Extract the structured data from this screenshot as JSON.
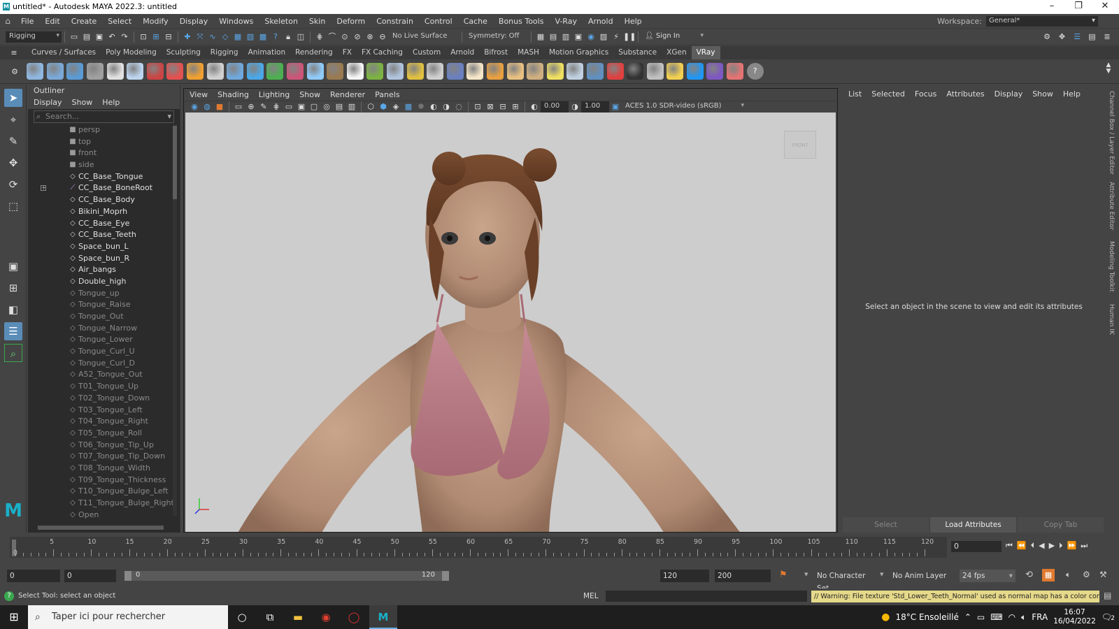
{
  "window": {
    "title": "untitled* - Autodesk MAYA 2022.3: untitled",
    "logo_letter": "M"
  },
  "menu": [
    "File",
    "Edit",
    "Create",
    "Select",
    "Modify",
    "Display",
    "Windows",
    "Skeleton",
    "Skin",
    "Deform",
    "Constrain",
    "Control",
    "Cache",
    "Bonus Tools",
    "V-Ray",
    "Arnold",
    "Help"
  ],
  "workspace": {
    "label": "Workspace:",
    "value": "General*"
  },
  "status": {
    "mode": "Rigging",
    "live_surface": "No Live Surface",
    "symmetry": "Symmetry: Off",
    "sign_in": "Sign In"
  },
  "shelf_tabs": [
    "Curves / Surfaces",
    "Poly Modeling",
    "Sculpting",
    "Rigging",
    "Animation",
    "Rendering",
    "FX",
    "FX Caching",
    "Custom",
    "Arnold",
    "Bifrost",
    "MASH",
    "Motion Graphics",
    "Substance",
    "XGen",
    "VRay"
  ],
  "shelf_active": "VRay",
  "shelf_icon_colors": [
    "#8fb7e0",
    "#7aa9d8",
    "#5b9bd5",
    "#a0a0a0",
    "#e0e0e0",
    "#bcd4ee",
    "#c44",
    "#e35050",
    "#f0a030",
    "#d0d0d0",
    "#6fa8dc",
    "#4aa8e8",
    "#4caf50",
    "#cc5577",
    "#90caf9",
    "#9a7a50",
    "#f5f5f5",
    "#7cb342",
    "#b0c4de",
    "#e0c040",
    "#cfcfcf",
    "#6a80c0",
    "#f5e6c8",
    "#e8a040",
    "#e8c080",
    "#d0b080",
    "#f0e060",
    "#c0d0e0",
    "#6090c0",
    "#e04040",
    "#333333",
    "#c0c0c0",
    "#f2d050",
    "#2196f3",
    "#7e57c2",
    "#e57373",
    "#888888"
  ],
  "outliner": {
    "title": "Outliner",
    "menu": [
      "Display",
      "Show",
      "Help"
    ],
    "search_placeholder": "Search...",
    "items": [
      {
        "label": "persp",
        "dim": true,
        "icon": "camera"
      },
      {
        "label": "top",
        "dim": true,
        "icon": "camera"
      },
      {
        "label": "front",
        "dim": true,
        "icon": "camera"
      },
      {
        "label": "side",
        "dim": true,
        "icon": "camera"
      },
      {
        "label": "CC_Base_Tongue",
        "dim": false,
        "icon": "mesh"
      },
      {
        "label": "CC_Base_BoneRoot",
        "dim": false,
        "icon": "joint",
        "expand": true
      },
      {
        "label": "CC_Base_Body",
        "dim": false,
        "icon": "mesh"
      },
      {
        "label": "Bikini_Moprh",
        "dim": false,
        "icon": "mesh"
      },
      {
        "label": "CC_Base_Eye",
        "dim": false,
        "icon": "mesh"
      },
      {
        "label": "CC_Base_Teeth",
        "dim": false,
        "icon": "mesh"
      },
      {
        "label": "Space_bun_L",
        "dim": false,
        "icon": "mesh"
      },
      {
        "label": "Space_bun_R",
        "dim": false,
        "icon": "mesh"
      },
      {
        "label": "Air_bangs",
        "dim": false,
        "icon": "mesh"
      },
      {
        "label": "Double_high",
        "dim": false,
        "icon": "mesh"
      },
      {
        "label": "Tongue_up",
        "dim": true,
        "icon": "mesh"
      },
      {
        "label": "Tongue_Raise",
        "dim": true,
        "icon": "mesh"
      },
      {
        "label": "Tongue_Out",
        "dim": true,
        "icon": "mesh"
      },
      {
        "label": "Tongue_Narrow",
        "dim": true,
        "icon": "mesh"
      },
      {
        "label": "Tongue_Lower",
        "dim": true,
        "icon": "mesh"
      },
      {
        "label": "Tongue_Curl_U",
        "dim": true,
        "icon": "mesh"
      },
      {
        "label": "Tongue_Curl_D",
        "dim": true,
        "icon": "mesh"
      },
      {
        "label": "A52_Tongue_Out",
        "dim": true,
        "icon": "mesh"
      },
      {
        "label": "T01_Tongue_Up",
        "dim": true,
        "icon": "mesh"
      },
      {
        "label": "T02_Tongue_Down",
        "dim": true,
        "icon": "mesh"
      },
      {
        "label": "T03_Tongue_Left",
        "dim": true,
        "icon": "mesh"
      },
      {
        "label": "T04_Tongue_Right",
        "dim": true,
        "icon": "mesh"
      },
      {
        "label": "T05_Tongue_Roll",
        "dim": true,
        "icon": "mesh"
      },
      {
        "label": "T06_Tongue_Tip_Up",
        "dim": true,
        "icon": "mesh"
      },
      {
        "label": "T07_Tongue_Tip_Down",
        "dim": true,
        "icon": "mesh"
      },
      {
        "label": "T08_Tongue_Width",
        "dim": true,
        "icon": "mesh"
      },
      {
        "label": "T09_Tongue_Thickness",
        "dim": true,
        "icon": "mesh"
      },
      {
        "label": "T10_Tongue_Bulge_Left",
        "dim": true,
        "icon": "mesh"
      },
      {
        "label": "T11_Tongue_Bulge_Right",
        "dim": true,
        "icon": "mesh"
      },
      {
        "label": "Open",
        "dim": true,
        "icon": "mesh"
      }
    ]
  },
  "viewport": {
    "menu": [
      "View",
      "Shading",
      "Lighting",
      "Show",
      "Renderer",
      "Panels"
    ],
    "exposure": "0.00",
    "gamma": "1.00",
    "colorspace": "ACES 1.0 SDR-video (sRGB)",
    "viewcube_label": "FRONT"
  },
  "attributes": {
    "menu": [
      "List",
      "Selected",
      "Focus",
      "Attributes",
      "Display",
      "Show",
      "Help"
    ],
    "message": "Select an object in the scene to view and edit its attributes",
    "buttons": [
      "Select",
      "Load Attributes",
      "Copy Tab"
    ]
  },
  "side_tabs": [
    "Channel Box / Layer Editor",
    "Attribute Editor",
    "Modeling Toolkit",
    "Human IK"
  ],
  "timeline": {
    "ticks": [
      "5",
      "10",
      "15",
      "20",
      "25",
      "30",
      "35",
      "40",
      "45",
      "50",
      "55",
      "60",
      "65",
      "70",
      "75",
      "80",
      "85",
      "90",
      "95",
      "100",
      "105",
      "110",
      "115",
      "120"
    ],
    "start_tick": "0",
    "current_frame": "0"
  },
  "range": {
    "start": "0",
    "anim_start": "0",
    "slider_start": "0",
    "slider_end": "120",
    "end": "120",
    "anim_end": "200",
    "character_set": "No Character Set",
    "anim_layer": "No Anim Layer",
    "fps": "24 fps"
  },
  "cmdline": {
    "help": "Select Tool: select an object",
    "mel": "MEL",
    "warning": "// Warning: File texture 'Std_Lower_Teeth_Normal' used as normal map has a color correction en"
  },
  "taskbar": {
    "search_placeholder": "Taper ici pour rechercher",
    "weather": "18°C Ensoleillé",
    "lang": "FRA",
    "time": "16:07",
    "date": "16/04/2022",
    "notif": "2"
  }
}
